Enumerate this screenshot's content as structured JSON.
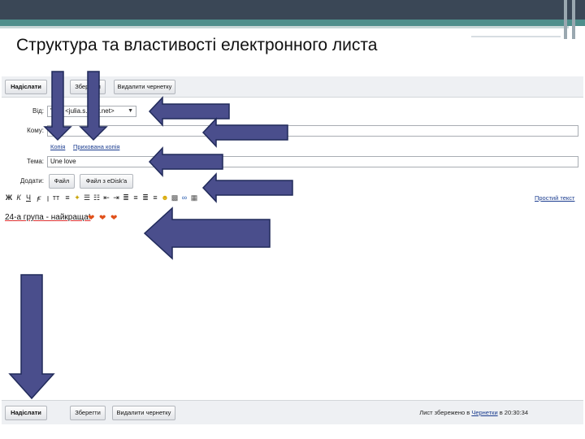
{
  "slide": {
    "title": "Структура та властивості електронного листа"
  },
  "email": {
    "toolbar": {
      "send_label": "Надіслати",
      "save_label": "Зберегти",
      "delete_draft_label": "Видалити чернетку"
    },
    "from": {
      "label": "Від:",
      "value": "\"Jul\" <julia.s...ukr.net>"
    },
    "to": {
      "label": "Кому:",
      "value": ""
    },
    "links": {
      "cc": "Копія",
      "bcc": "Прихована копія"
    },
    "subject": {
      "label": "Тема:",
      "value": "Une love"
    },
    "attach": {
      "label": "Додати:",
      "file_label": "Файл",
      "edisk_label": "Файл з eDisk'a"
    },
    "formatting": {
      "plain_text_link": "Простий текст"
    },
    "body": {
      "text": "24-а група - найкраща!"
    },
    "bottom": {
      "send_label": "Надіслати",
      "save_label": "Зберегти",
      "delete_draft_label": "Видалити чернетку",
      "status_prefix": "Лист збережено в",
      "status_folder": "Чернетки",
      "status_time": "в 20:30:34"
    }
  },
  "colors": {
    "arrow_fill": "#4a4e8c",
    "arrow_stroke": "#202a5a",
    "header_dark": "#3a4756",
    "header_teal": "#4f8f8c"
  }
}
